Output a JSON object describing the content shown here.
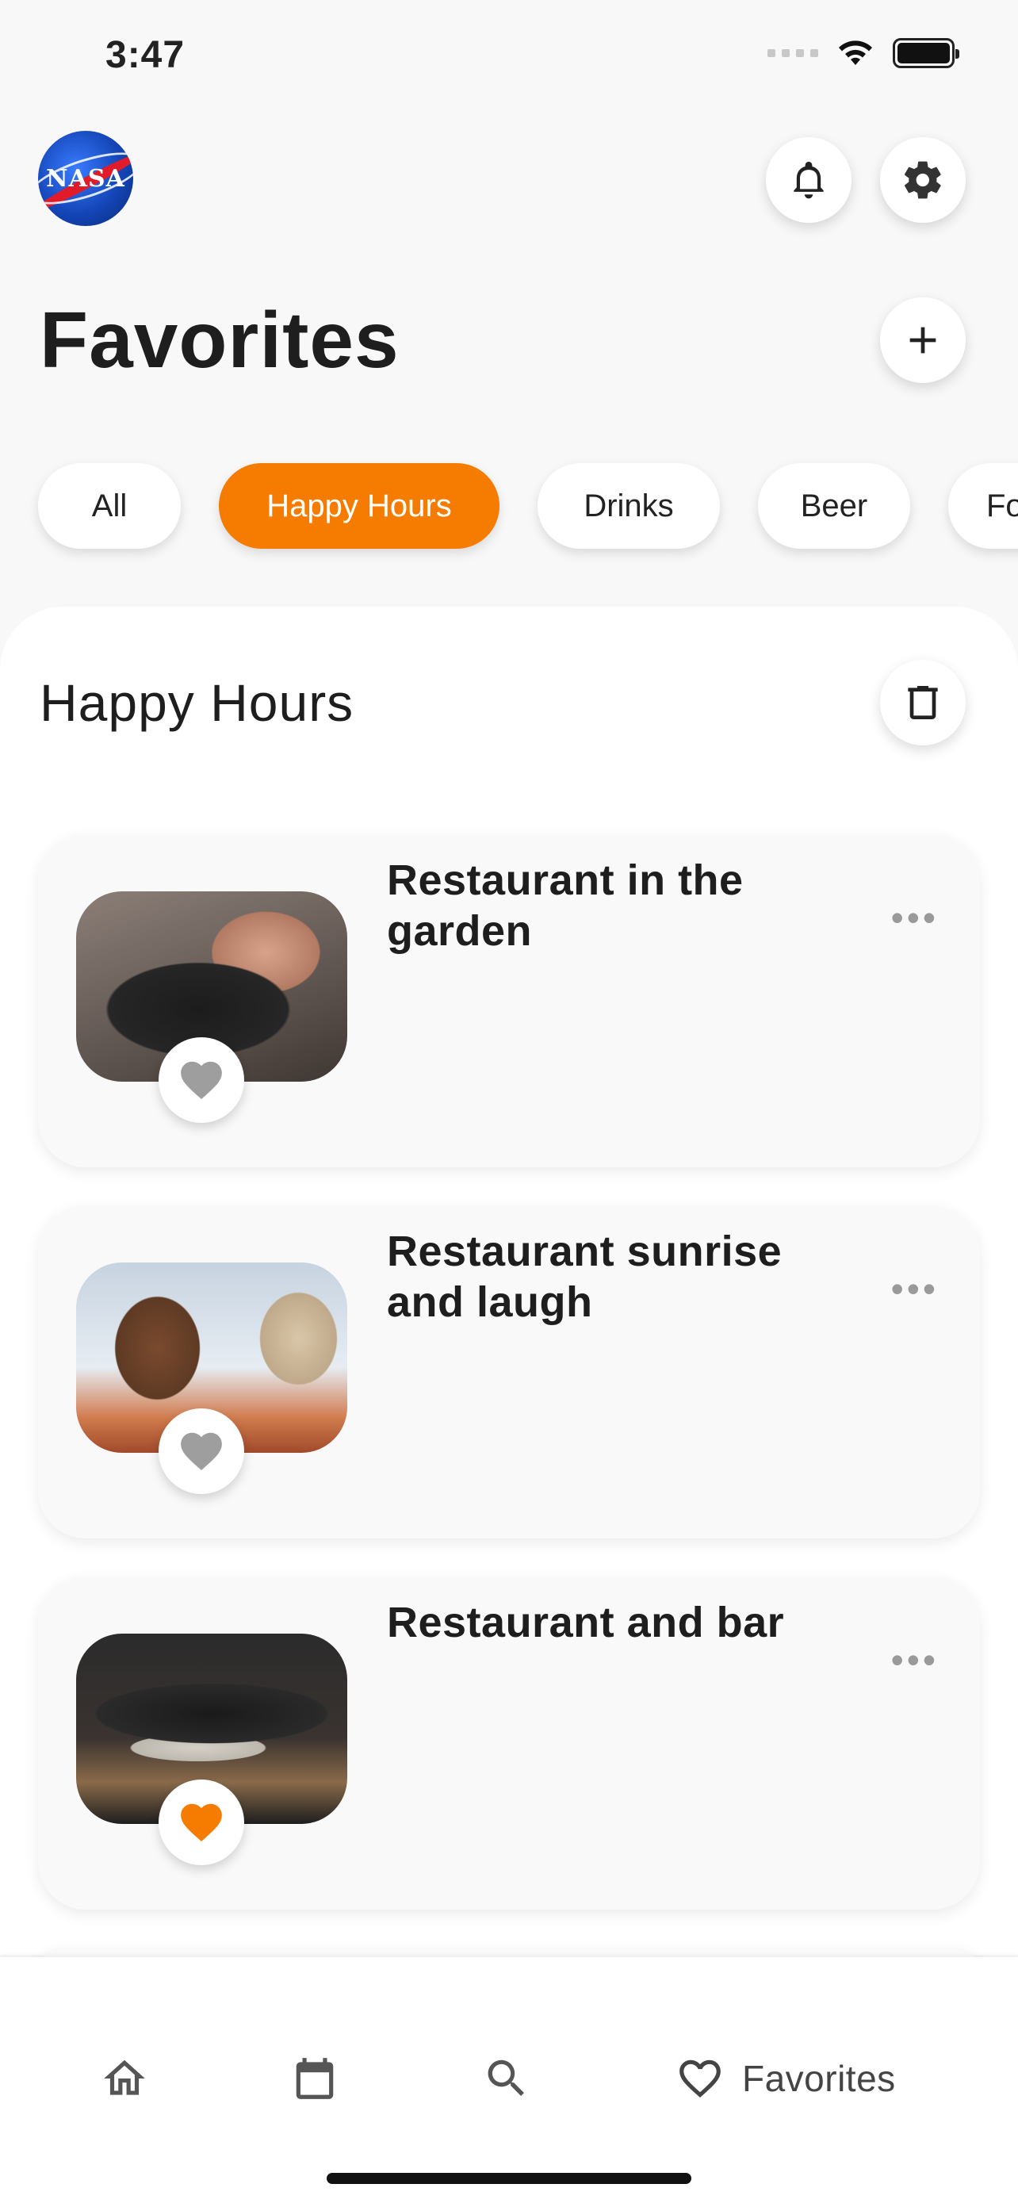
{
  "status_bar": {
    "time": "3:47"
  },
  "header": {
    "logo_text": "NASA",
    "title": "Favorites",
    "notification_icon": "bell-icon",
    "settings_icon": "gear-icon",
    "add_icon": "plus-icon"
  },
  "filters": [
    {
      "label": "All",
      "active": false
    },
    {
      "label": "Happy Hours",
      "active": true
    },
    {
      "label": "Drinks",
      "active": false
    },
    {
      "label": "Beer",
      "active": false
    },
    {
      "label": "Fo",
      "active": false
    }
  ],
  "section": {
    "title": "Happy Hours",
    "delete_icon": "trash-icon"
  },
  "cards": [
    {
      "title": "Restaurant in the garden",
      "favorite": false
    },
    {
      "title": "Restaurant sunrise and laugh",
      "favorite": false
    },
    {
      "title": "Restaurant and bar",
      "favorite": true
    }
  ],
  "bottom_nav": [
    {
      "icon": "home-icon",
      "label": ""
    },
    {
      "icon": "calendar-icon",
      "label": ""
    },
    {
      "icon": "search-icon",
      "label": ""
    },
    {
      "icon": "heart-icon",
      "label": "Favorites",
      "active": true
    }
  ],
  "colors": {
    "accent": "#f57c00",
    "heart_inactive": "#9e9e9e",
    "background": "#f8f8f8"
  }
}
